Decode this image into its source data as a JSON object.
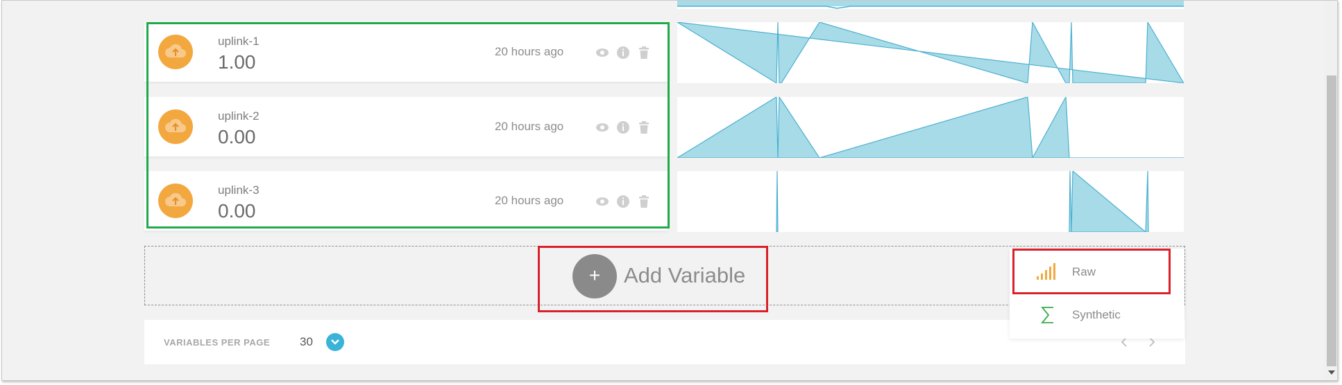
{
  "variables": [
    {
      "name": "uplink-1",
      "value": "1.00",
      "time": "20 hours ago"
    },
    {
      "name": "uplink-2",
      "value": "0.00",
      "time": "20 hours ago"
    },
    {
      "name": "uplink-3",
      "value": "0.00",
      "time": "20 hours ago"
    }
  ],
  "icons": {
    "variable": "cloud-upload-icon",
    "view": "eye-icon",
    "info": "info-icon",
    "delete": "trash-icon",
    "raw": "signal-bars-icon",
    "synthetic": "sigma-icon"
  },
  "add": {
    "label": "Add Variable",
    "plus": "+"
  },
  "dropdown": {
    "items": [
      {
        "label": "Raw"
      },
      {
        "label": "Synthetic"
      }
    ]
  },
  "pagination": {
    "label": "VARIABLES PER PAGE",
    "value": "30"
  },
  "colors": {
    "accent_orange": "#f2a83f",
    "sparkline_fill": "#a8dbe8",
    "sparkline_stroke": "#4bb0cf",
    "highlight_green": "#1fa94a",
    "highlight_red": "#d9212b",
    "dropdown_blue": "#3ab3d9",
    "synthetic_green": "#3aaa4a"
  }
}
